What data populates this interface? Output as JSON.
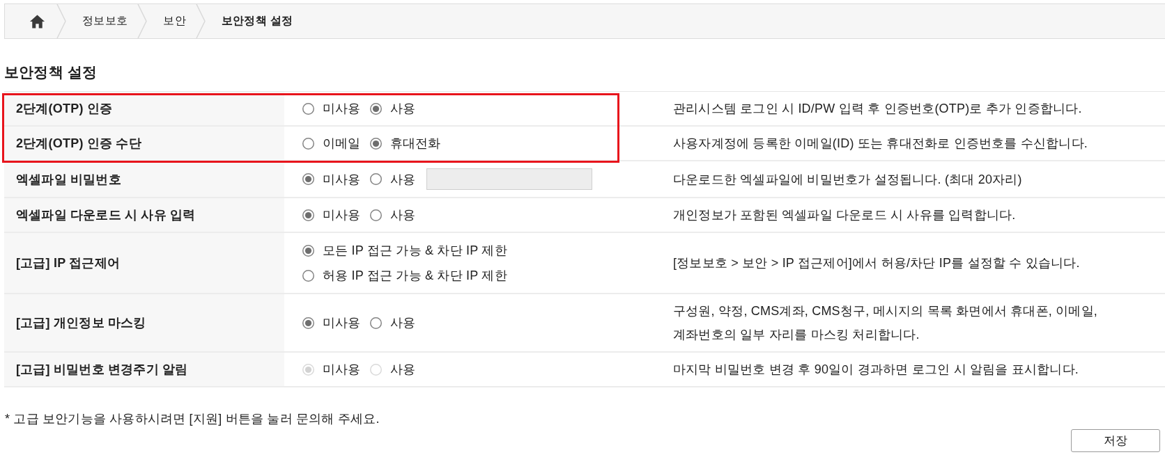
{
  "breadcrumb": {
    "items": [
      {
        "label": "정보보호",
        "current": false
      },
      {
        "label": "보안",
        "current": false
      },
      {
        "label": "보안정책 설정",
        "current": true
      }
    ]
  },
  "page_title": "보안정책 설정",
  "settings": [
    {
      "label": "2단계(OTP) 인증",
      "highlighted": true,
      "kind": "inline",
      "disabled": false,
      "options": [
        {
          "label": "미사용",
          "selected": false
        },
        {
          "label": "사용",
          "selected": true
        }
      ],
      "description": "관리시스템 로그인 시 ID/PW 입력 후 인증번호(OTP)로 추가 인증합니다."
    },
    {
      "label": "2단계(OTP) 인증 수단",
      "highlighted": true,
      "kind": "inline",
      "disabled": false,
      "options": [
        {
          "label": "이메일",
          "selected": false
        },
        {
          "label": "휴대전화",
          "selected": true
        }
      ],
      "description": "사용자계정에 등록한 이메일(ID) 또는 휴대전화로 인증번호를 수신합니다."
    },
    {
      "label": "엑셀파일 비밀번호",
      "highlighted": false,
      "kind": "inline",
      "disabled": false,
      "options": [
        {
          "label": "미사용",
          "selected": true
        },
        {
          "label": "사용",
          "selected": false
        }
      ],
      "field": {
        "disabled": true
      },
      "description": "다운로드한 엑셀파일에 비밀번호가 설정됩니다. (최대 20자리)"
    },
    {
      "label": "엑셀파일 다운로드 시 사유 입력",
      "highlighted": false,
      "kind": "inline",
      "disabled": false,
      "options": [
        {
          "label": "미사용",
          "selected": true
        },
        {
          "label": "사용",
          "selected": false
        }
      ],
      "description": "개인정보가 포함된 엑셀파일 다운로드 시 사유를 입력합니다."
    },
    {
      "label": "[고급] IP 접근제어",
      "highlighted": false,
      "kind": "stacked",
      "disabled": false,
      "options": [
        {
          "label": "모든 IP 접근 가능 & 차단 IP 제한",
          "selected": true
        },
        {
          "label": "허용 IP 접근 가능 & 차단 IP 제한",
          "selected": false
        }
      ],
      "description": "[정보보호 > 보안 > IP 접근제어]에서 허용/차단 IP를 설정할 수 있습니다."
    },
    {
      "label": "[고급] 개인정보 마스킹",
      "highlighted": false,
      "kind": "inline",
      "disabled": false,
      "options": [
        {
          "label": "미사용",
          "selected": true
        },
        {
          "label": "사용",
          "selected": false
        }
      ],
      "description": "구성원, 약정, CMS계좌, CMS청구, 메시지의 목록 화면에서 휴대폰, 이메일,\n계좌번호의 일부 자리를 마스킹 처리합니다."
    },
    {
      "label": "[고급] 비밀번호 변경주기 알림",
      "highlighted": false,
      "kind": "inline",
      "disabled": true,
      "options": [
        {
          "label": "미사용",
          "selected": true
        },
        {
          "label": "사용",
          "selected": false
        }
      ],
      "description": "마지막 비밀번호 변경 후 90일이 경과하면 로그인 시 알림을 표시합니다."
    }
  ],
  "note": "* 고급 보안기능을 사용하시려면 [지원] 버튼을 눌러 문의해 주세요.",
  "save_button": {
    "label": "저장"
  }
}
